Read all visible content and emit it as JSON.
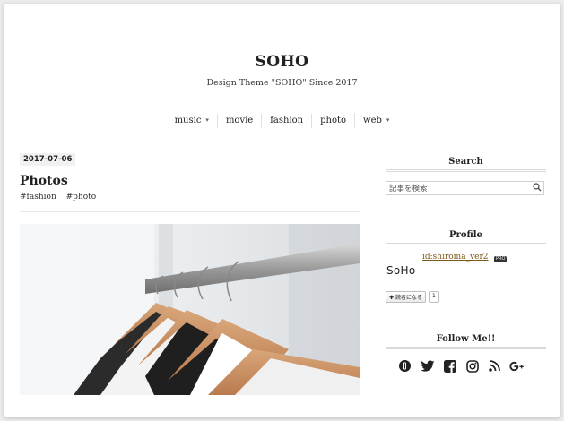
{
  "header": {
    "site_title": "SOHO",
    "tagline": "Design Theme \"SOHO\" Since 2017"
  },
  "nav": {
    "items": [
      {
        "label": "music",
        "has_dropdown": true
      },
      {
        "label": "movie",
        "has_dropdown": false
      },
      {
        "label": "fashion",
        "has_dropdown": false
      },
      {
        "label": "photo",
        "has_dropdown": false
      },
      {
        "label": "web",
        "has_dropdown": true
      }
    ],
    "caret": "▾"
  },
  "post": {
    "date": "2017-07-06",
    "title": "Photos",
    "tags": [
      "#fashion",
      "#photo"
    ]
  },
  "sidebar": {
    "search": {
      "title": "Search",
      "placeholder": "記事を検索",
      "icon": "search-icon"
    },
    "profile": {
      "title": "Profile",
      "id": "id:shiroma_ver2",
      "badge": "PRO",
      "logo_text": "SoHo",
      "reader_label": "読者になる",
      "reader_count": "1"
    },
    "follow": {
      "title": "Follow Me!!",
      "icons": [
        "hatena-icon",
        "twitter-icon",
        "facebook-icon",
        "instagram-icon",
        "rss-icon",
        "google-plus-icon"
      ]
    }
  },
  "colors": {
    "accent": "#222222",
    "link": "#7a5a1a"
  }
}
